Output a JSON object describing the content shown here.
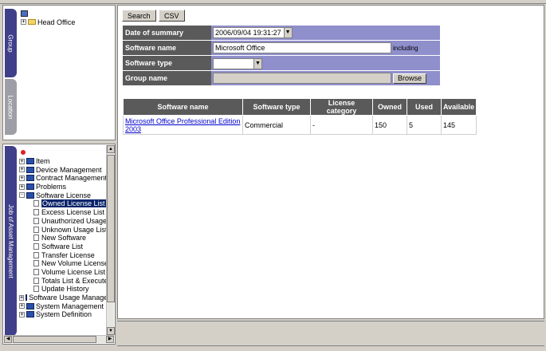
{
  "left_top": {
    "tabs": [
      "Group",
      "Location"
    ],
    "tree": [
      {
        "label": "Head Office"
      }
    ]
  },
  "left_bottom": {
    "tab": "Job of Asset Management",
    "items": [
      {
        "label": "Item"
      },
      {
        "label": "Device Management"
      },
      {
        "label": "Contract Management"
      },
      {
        "label": "Problems"
      },
      {
        "label": "Software License"
      }
    ],
    "software_license_children": [
      {
        "label": "Owned License List",
        "selected": true
      },
      {
        "label": "Excess License List"
      },
      {
        "label": "Unauthorized Usage"
      },
      {
        "label": "Unknown Usage List"
      },
      {
        "label": "New Software"
      },
      {
        "label": "Software List"
      },
      {
        "label": "Transfer License"
      },
      {
        "label": "New Volume License"
      },
      {
        "label": "Volume License List"
      },
      {
        "label": "Totals List & Execute"
      },
      {
        "label": "Update History"
      }
    ],
    "items_after": [
      {
        "label": "Software Usage Management"
      },
      {
        "label": "System Management"
      },
      {
        "label": "System Definition"
      }
    ]
  },
  "toolbar": {
    "search_label": "Search",
    "csv_label": "CSV"
  },
  "form": {
    "date_label": "Date of summary",
    "date_value": "2006/09/04 19:31:27",
    "software_name_label": "Software name",
    "software_name_value": "Microsoft Office",
    "including_text": "including",
    "software_type_label": "Software type",
    "software_type_value": "",
    "group_name_label": "Group name",
    "group_name_value": "",
    "browse_label": "Browse"
  },
  "results": {
    "columns": [
      "Software name",
      "Software type",
      "License category",
      "Owned",
      "Used",
      "Available"
    ],
    "rows": [
      {
        "name": "Microsoft Office Professional Edition 2003",
        "type": "Commercial",
        "category": "-",
        "owned": "150",
        "used": "5",
        "available": "145"
      }
    ]
  }
}
